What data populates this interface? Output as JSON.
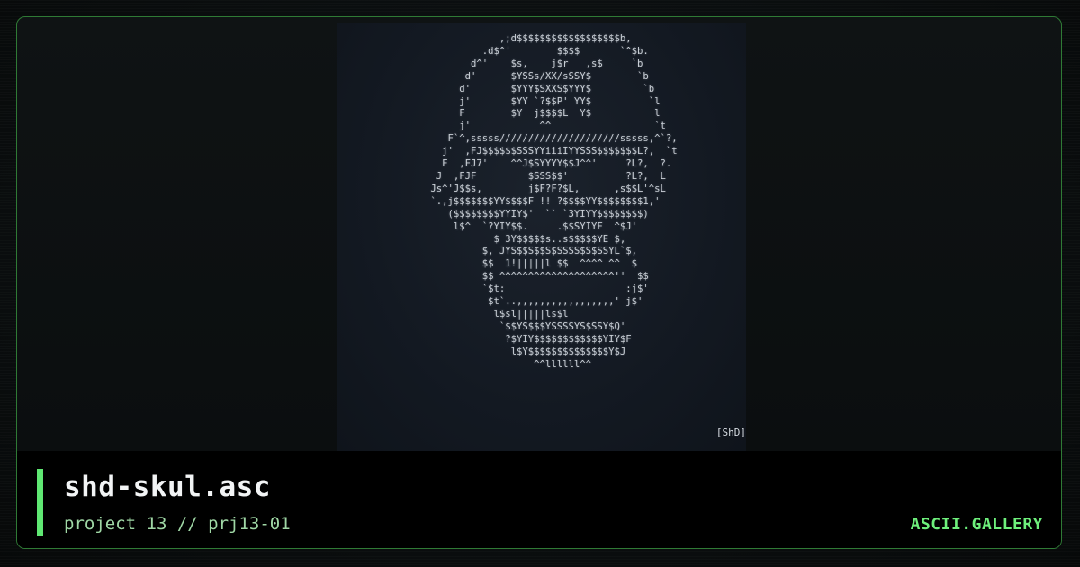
{
  "artwork": {
    "ascii_lines": [
      "             ,;d$$$$$$$$$$$$$$$$$$b,",
      "          .d$^'        $$$$       `^$b.",
      "        d^'    $s,    j$r   ,s$     `b",
      "       d'      $YSSs/XX/sSSY$        `b",
      "      d'       $YYY$SXXS$YYY$         `b",
      "      j'       $YY `?$$P' YY$          `l",
      "      F        $Y  j$$$$L  Y$           l",
      "      j'            ^^                  `t",
      "    F`^,sssss/////////////////////sssss,^`?,",
      "   j'  ,FJ$$$$$$SSSYYiiiIYYSSS$$$$$$$L?,  `t",
      "   F  ,FJ7'    ^^J$SYYYY$$J^^'     ?L?,  ?.",
      "  J  ,FJF         $SSS$$'          ?L?,  L",
      " Js^'J$$s,        j$F?F?$L,      ,s$$L'^sL",
      " `.,j$$$$$$$YY$$$$F !! ?$$$$YY$$$$$$$$1,'",
      "    ($$$$$$$$YYIY$'  `` `3YIYY$$$$$$$$)",
      "     l$^  `?YIY$$.     .$$SYIYF  ^$J'",
      "            $ 3Y$$$$$s..s$$$$$YE $,",
      "          $, JYS$$S$$S$SSSS$S$SSYL`$,",
      "          $$  1!|||||l $$  ^^^^ ^^  $",
      "          $$ ^^^^^^^^^^^^^^^^^^^^''  $$",
      "          `$t:                     :j$'",
      "           $t`..,,,,,,,,,,,,,,,,,' j$'",
      "            l$sl|||||ls$l",
      "             `$$YS$$$YSSSSYS$SSY$Q'",
      "              ?$YIY$$$$$$$$$$$$YIY$F",
      "               l$Y$$$$$$$$$$$$$$Y$J",
      "                   ^^llllll^^"
    ],
    "artist_tag": "[ShD]"
  },
  "caption": {
    "title": "shd-skul.asc",
    "subtitle": "project 13 // prj13-01",
    "brand": "ASCII.GALLERY"
  },
  "colors": {
    "accent": "#5fe873",
    "brand": "#6ef07c",
    "frame_border": "#2f7a35",
    "subtitle": "#9fd7a5",
    "ascii_text": "#c9cfd6"
  }
}
